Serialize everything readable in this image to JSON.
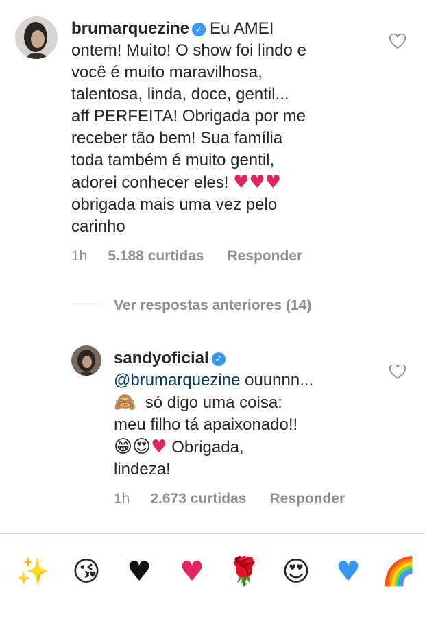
{
  "comments": [
    {
      "username": "brumarquezine",
      "verified": true,
      "lines": [
        "Eu AMEI",
        "ontem! Muito! O show foi lindo e",
        "você é muito maravilhosa,",
        "talentosa, linda, doce, gentil...",
        "aff PERFEITA! Obrigada por me",
        "receber tão bem! Sua família",
        "toda também é muito gentil,",
        "adorei conhecer eles!",
        "obrigada mais uma vez pelo",
        "carinho"
      ],
      "time": "1h",
      "likes": "5.188 curtidas",
      "reply": "Responder"
    },
    {
      "username": "sandyoficial",
      "verified": true,
      "mention": "@brumarquezine",
      "lines": [
        "ouunnn...",
        "só digo uma coisa:",
        "meu filho tá apaixonado!!",
        "Obrigada,",
        "lindeza!"
      ],
      "time": "1h",
      "likes": "2.673 curtidas",
      "reply": "Responder"
    }
  ],
  "view_replies": "Ver respostas anteriores (14)",
  "emoji_bar": [
    {
      "icon": "sparkles-icon",
      "glyph": "✨"
    },
    {
      "icon": "kiss-face-icon",
      "glyph": "😘"
    },
    {
      "icon": "black-heart-icon",
      "glyph": "♥"
    },
    {
      "icon": "red-heart-icon",
      "glyph": "♥"
    },
    {
      "icon": "rose-icon",
      "glyph": "🌹"
    },
    {
      "icon": "heart-eyes-icon",
      "glyph": "😍"
    },
    {
      "icon": "blue-heart-icon",
      "glyph": "♥"
    },
    {
      "icon": "rainbow-icon",
      "glyph": "🌈"
    }
  ],
  "colors": {
    "verified": "#3897f0",
    "mention": "#00376b",
    "heart_red": "#e0245e",
    "heart_black": "#111111",
    "heart_blue": "#3897f0",
    "meta_gray": "#8e8e8e"
  }
}
